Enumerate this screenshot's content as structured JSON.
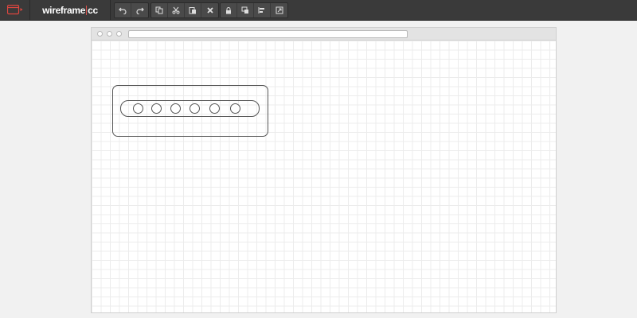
{
  "app": {
    "brand_left": "wireframe",
    "brand_right": "cc",
    "accent_color": "#d9534f"
  },
  "toolbar": {
    "menu_icon": "browser-window-icon",
    "groups": [
      [
        "undo-icon",
        "redo-icon"
      ],
      [
        "copy-icon",
        "cut-icon",
        "paste-icon",
        "delete-icon"
      ],
      [
        "lock-icon",
        "bring-to-front-icon",
        "align-icon",
        "resize-icon"
      ]
    ]
  },
  "browser_mock": {
    "dots": 3,
    "url": ""
  },
  "canvas": {
    "widget": {
      "type": "rounded-box-with-pill",
      "circle_count": 6
    }
  }
}
